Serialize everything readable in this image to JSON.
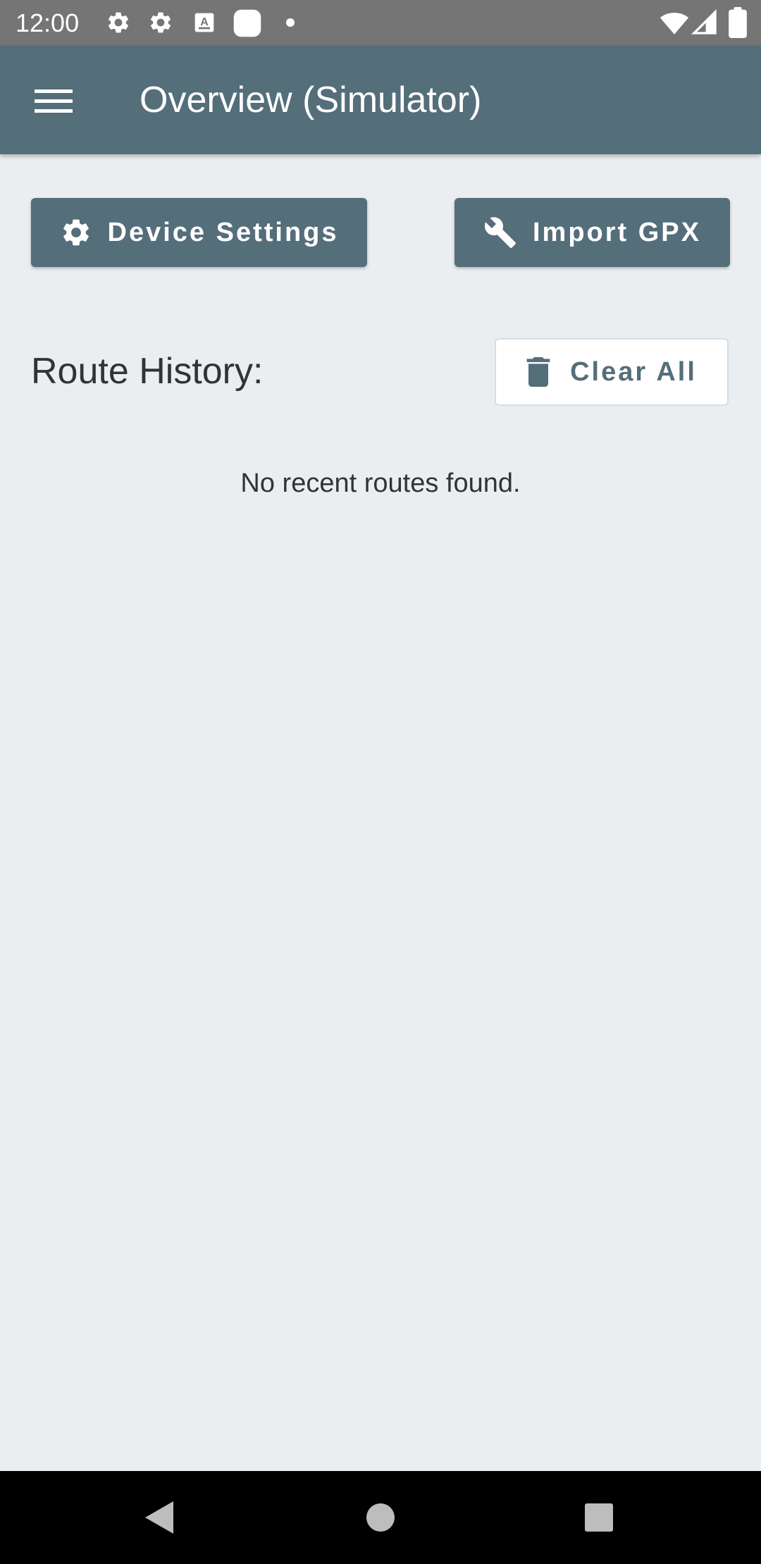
{
  "status_bar": {
    "time": "12:00",
    "background": "#757575",
    "icons": [
      "settings-icon",
      "settings-icon",
      "keyboard-a-icon",
      "app-square-icon",
      "notification-dot-icon",
      "wifi-icon",
      "signal-icon",
      "battery-icon"
    ]
  },
  "app_bar": {
    "title": "Overview (Simulator)",
    "menu_icon": "hamburger-menu-icon",
    "background": "#546e7a"
  },
  "actions": {
    "device_settings": {
      "label": "Device Settings",
      "icon": "gear-icon"
    },
    "import_gpx": {
      "label": "Import GPX",
      "icon": "wrench-icon"
    }
  },
  "route_history": {
    "title": "Route History:",
    "clear_all": {
      "label": "Clear All",
      "icon": "trash-icon"
    },
    "empty_message": "No recent routes found."
  },
  "nav_bar": {
    "buttons": [
      "back-triangle-icon",
      "home-circle-icon",
      "recents-square-icon"
    ]
  },
  "colors": {
    "accent": "#546e7a",
    "background": "#eaeef1",
    "text": "#333333"
  }
}
